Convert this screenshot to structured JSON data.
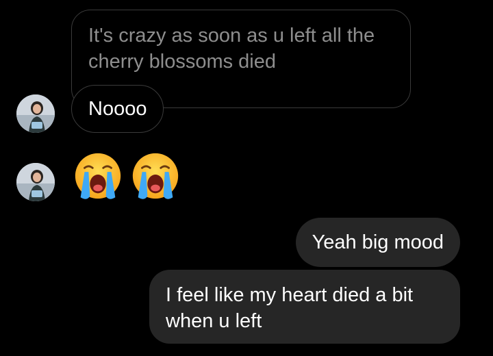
{
  "messages": {
    "received": [
      {
        "text": "It's crazy as soon as u left all the cherry blossoms died"
      },
      {
        "text": "Noooo"
      }
    ],
    "sent": [
      {
        "text": "Yeah big mood"
      },
      {
        "text": "I feel like my heart died a bit when u left"
      }
    ],
    "emoji": [
      "loudly-crying-face",
      "loudly-crying-face"
    ]
  },
  "colors": {
    "background": "#000000",
    "sent_bubble": "#262626",
    "received_border": "#3b3b3b",
    "replied_text": "#8e8e8e"
  }
}
